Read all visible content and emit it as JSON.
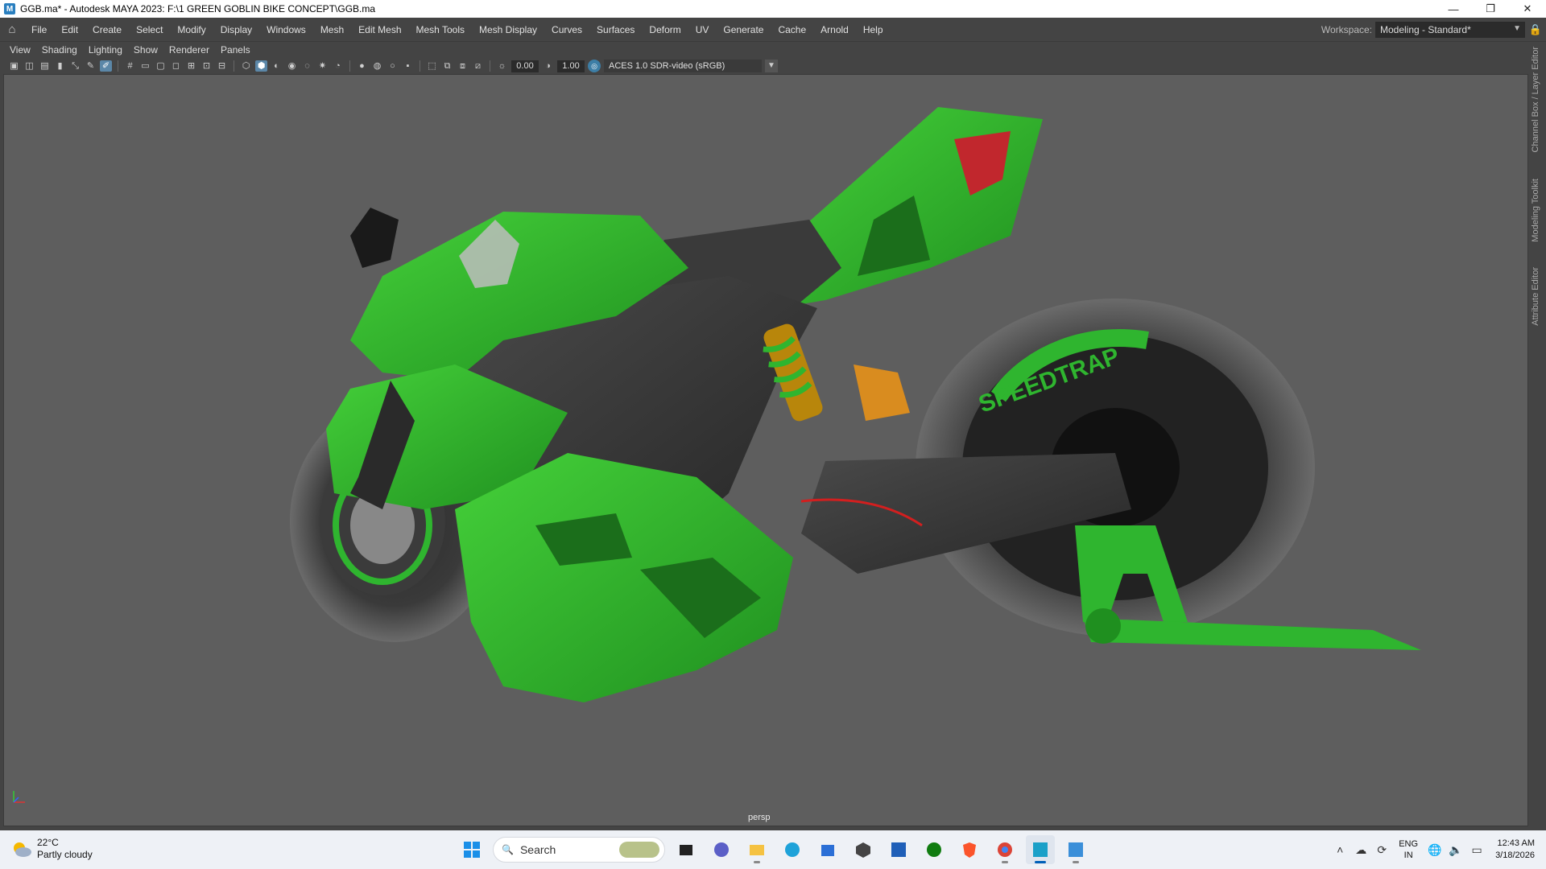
{
  "window": {
    "title": "GGB.ma* - Autodesk MAYA 2023: F:\\1 GREEN GOBLIN BIKE CONCEPT\\GGB.ma",
    "app_icon_letter": "M",
    "minimize_glyph": "—",
    "restore_glyph": "❐",
    "close_glyph": "✕"
  },
  "menubar": {
    "items": [
      "File",
      "Edit",
      "Create",
      "Select",
      "Modify",
      "Display",
      "Windows",
      "Mesh",
      "Edit Mesh",
      "Mesh Tools",
      "Mesh Display",
      "Curves",
      "Surfaces",
      "Deform",
      "UV",
      "Generate",
      "Cache",
      "Arnold",
      "Help"
    ],
    "workspace_label": "Workspace:",
    "workspace_value": "Modeling - Standard*"
  },
  "panel_menu": {
    "items": [
      "View",
      "Shading",
      "Lighting",
      "Show",
      "Renderer",
      "Panels"
    ]
  },
  "panel_toolbar": {
    "exposure": "0.00",
    "gamma": "1.00",
    "color_management": "ACES 1.0 SDR-video (sRGB)"
  },
  "viewport": {
    "camera_label": "persp",
    "background_color": "#5e5e5e",
    "body_color": "#2fb52f",
    "rim_text": "SPEEDTRAP"
  },
  "side_tabs": [
    "Channel Box / Layer Editor",
    "Modeling Toolkit",
    "Attribute Editor"
  ],
  "taskbar": {
    "weather_temp": "22°C",
    "weather_desc": "Partly cloudy",
    "search_label": "Search",
    "apps": [
      "start-icon",
      "task-view-icon",
      "teams-icon",
      "file-explorer-icon",
      "edge-icon",
      "store-icon",
      "unity-icon",
      "affinity-icon",
      "xbox-icon",
      "brave-icon",
      "chrome-icon",
      "maya-icon",
      "paint-icon"
    ],
    "lang_top": "ENG",
    "lang_bottom": "IN",
    "time": "12:43 AM",
    "date": "3/18/2026"
  }
}
